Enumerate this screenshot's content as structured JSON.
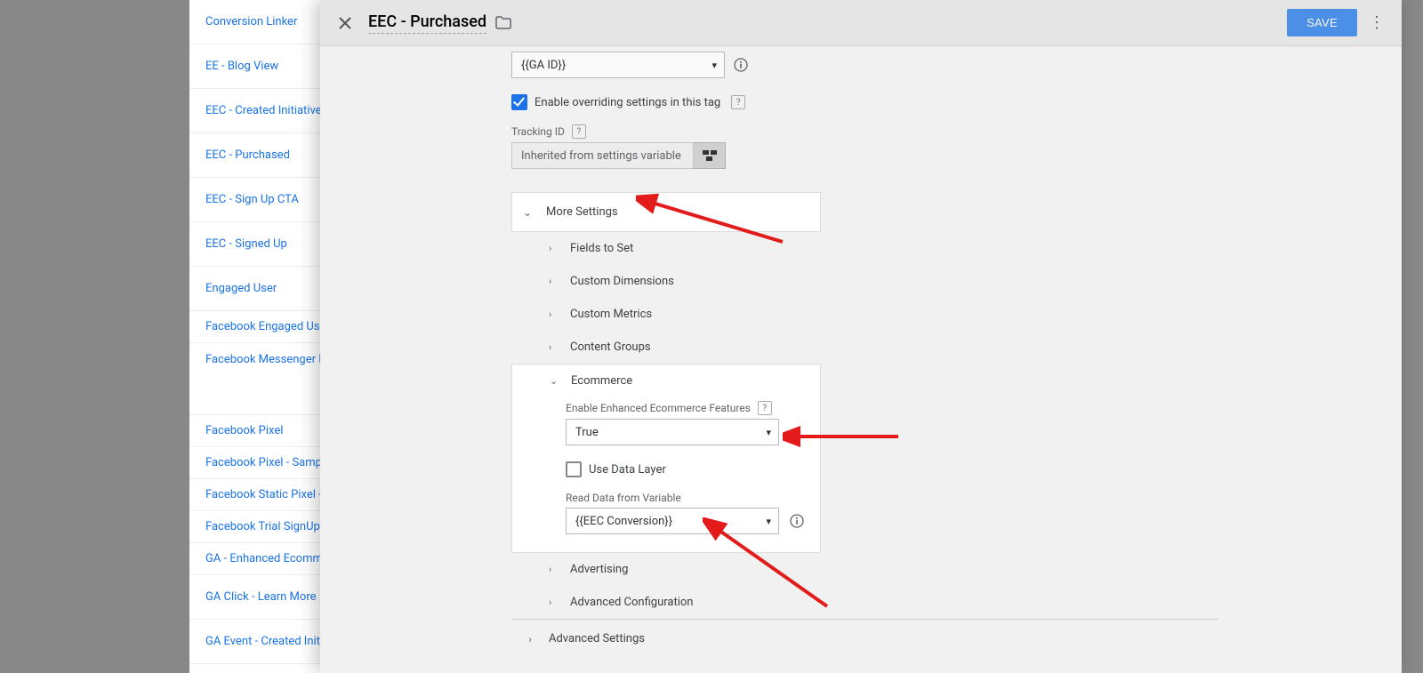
{
  "bg_tags": {
    "a": "Conversion Linker",
    "b": "EE - Blog View",
    "c": "EEC - Created Initiative",
    "d": "EEC - Purchased",
    "e": "EEC - Sign Up CTA",
    "f": "EEC - Signed Up",
    "g": "Engaged User",
    "h": "Facebook Engaged User",
    "i": "Facebook Messenger HT",
    "j": "Facebook Pixel",
    "k": "Facebook Pixel - Sample",
    "l": "Facebook Static Pixel - S",
    "m": "Facebook Trial SignUp",
    "n": "GA - Enhanced Ecommer",
    "o": "GA Click - Learn More",
    "p": "GA Event - Created Initiat"
  },
  "header": {
    "title": "EEC - Purchased",
    "save": "SAVE"
  },
  "form": {
    "ga_select": "{{GA ID}}",
    "override_label": "Enable overriding settings in this tag",
    "tracking_label": "Tracking ID",
    "tracking_value": "Inherited from settings variable",
    "more_settings": "More Settings",
    "rows": {
      "fields": "Fields to Set",
      "dims": "Custom Dimensions",
      "metrics": "Custom Metrics",
      "groups": "Content Groups",
      "ecomm": "Ecommerce",
      "adv": "Advertising",
      "advcfg": "Advanced Configuration"
    },
    "ecomm": {
      "enable_label": "Enable Enhanced Ecommerce Features",
      "enable_value": "True",
      "use_dl": "Use Data Layer",
      "read_var_label": "Read Data from Variable",
      "read_var_value": "{{EEC Conversion}}"
    },
    "advanced": "Advanced Settings"
  }
}
